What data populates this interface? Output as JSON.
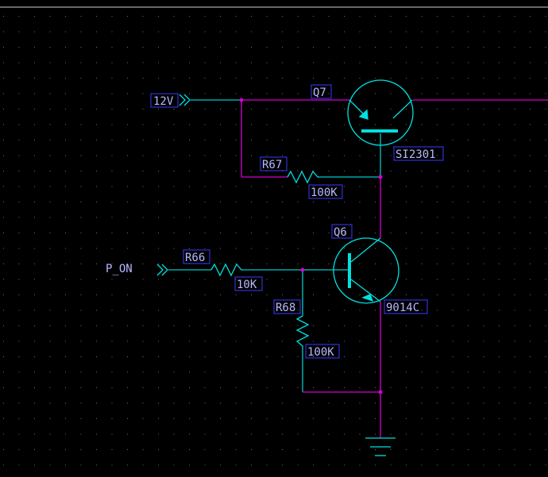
{
  "colors": {
    "background": "#000000",
    "grid_dot": "#6f6f6f",
    "top_line": "#cfcfcf",
    "wire_cyan": "#00c8c8",
    "wire_magenta": "#d400d4",
    "component": "#00e0e0",
    "text": "#b8b8ff",
    "label_box": "#3a3aff"
  },
  "ports": {
    "v12": {
      "label": "12V"
    },
    "p_on": {
      "label": "P_ON"
    }
  },
  "components": {
    "q7": {
      "ref": "Q7",
      "value": "SI2301"
    },
    "q6": {
      "ref": "Q6",
      "value": "9014C"
    },
    "r67": {
      "ref": "R67",
      "value": "100K"
    },
    "r66": {
      "ref": "R66",
      "value": "10K"
    },
    "r68": {
      "ref": "R68",
      "value": "100K"
    }
  },
  "icons": {
    "ground": "ground-icon",
    "port": "input-port-arrow-icon"
  }
}
